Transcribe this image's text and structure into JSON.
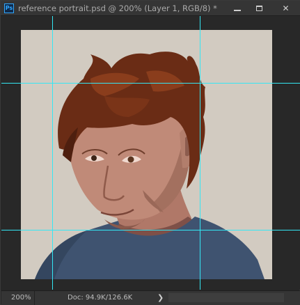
{
  "window": {
    "app_icon_text": "Ps",
    "title": "reference portrait.psd @ 200% (Layer 1, RGB/8) *",
    "controls": {
      "minimize": "minimize-icon",
      "maximize": "maximize-icon",
      "close": "✕"
    }
  },
  "statusbar": {
    "zoom": "200%",
    "doc_info": "Doc: 94.9K/126.6K",
    "arrow": "❯"
  },
  "colors": {
    "guide": "#34e7f4",
    "canvas_background": "#d2cbc1",
    "ps_accent": "#31a8ff"
  }
}
